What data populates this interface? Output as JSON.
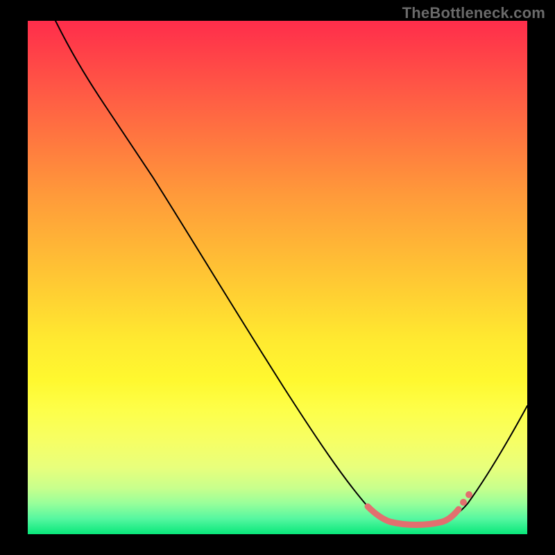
{
  "watermark": "TheBottleneck.com",
  "chart_data": {
    "type": "line",
    "title": "",
    "xlabel": "",
    "ylabel": "",
    "xlim": [
      0,
      100
    ],
    "ylim": [
      0,
      100
    ],
    "grid": false,
    "legend": false,
    "series": [
      {
        "name": "curve",
        "x": [
          5,
          10,
          15,
          20,
          25,
          30,
          35,
          40,
          45,
          50,
          55,
          60,
          65,
          70,
          72,
          75,
          78,
          80,
          82,
          85,
          88,
          92,
          96,
          100
        ],
        "y": [
          100,
          95,
          90,
          84,
          77,
          70,
          63,
          55,
          47,
          40,
          33,
          26,
          19,
          12,
          8,
          5,
          3,
          2,
          2,
          2,
          3,
          8,
          16,
          25
        ]
      }
    ],
    "optimal_zone": {
      "x_start": 70,
      "x_end": 88,
      "y": 2
    },
    "annotations": [],
    "background": "vertical-gradient red→orange→yellow→green",
    "gradient_stops": [
      {
        "pos": 0.0,
        "color": "#ff2d4b"
      },
      {
        "pos": 0.24,
        "color": "#ff7a3f"
      },
      {
        "pos": 0.54,
        "color": "#ffd232"
      },
      {
        "pos": 0.76,
        "color": "#fdff4a"
      },
      {
        "pos": 0.94,
        "color": "#98ff9a"
      },
      {
        "pos": 1.0,
        "color": "#08e77a"
      }
    ]
  }
}
